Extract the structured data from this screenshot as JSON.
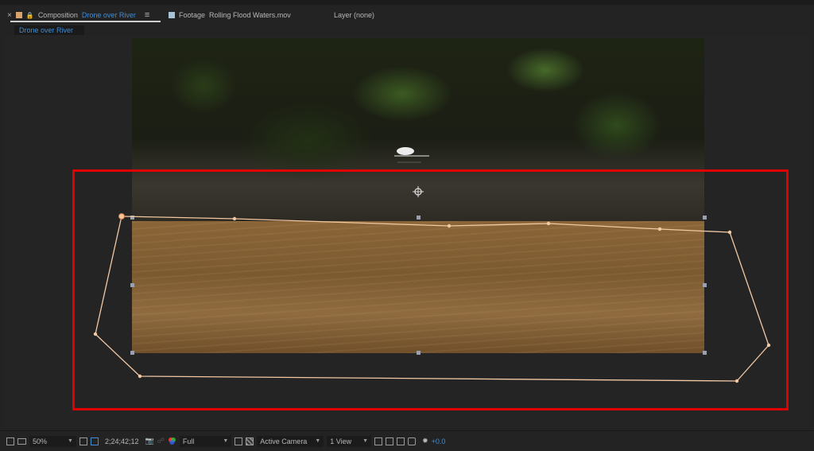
{
  "tabs": {
    "close_glyph": "×",
    "hamburger": "≡",
    "composition_prefix": "Composition",
    "composition_name": "Drone over River",
    "footage_prefix": "Footage",
    "footage_name": "Rolling Flood Waters.mov",
    "layer_label": "Layer (none)"
  },
  "subtab": {
    "label": "Drone over River"
  },
  "statusbar": {
    "zoom": "50%",
    "timecode": "2;24;42;12",
    "resolution": "Full",
    "camera": "Active Camera",
    "view": "1 View",
    "exposure": "+0.0"
  },
  "colors": {
    "accent_blue": "#3f8ed6",
    "mask_path": "#f3c9a4",
    "highlight_box": "#e00000",
    "comp_label": "#d9a46c",
    "footage_label": "#a7c3d6"
  },
  "icons": [
    "close-icon",
    "lock-icon",
    "menu-icon",
    "film-icon",
    "camera-icon",
    "color-channels-icon",
    "grid-icon",
    "mask-toggle-icon",
    "region-icon",
    "transparency-icon",
    "flowchart-icon",
    "exposure-icon"
  ]
}
